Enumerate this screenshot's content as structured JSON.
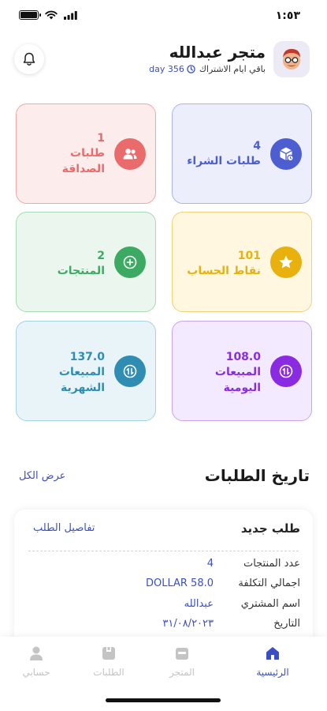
{
  "status_bar": {
    "time": "١:٥٣"
  },
  "header": {
    "store_name": "متجر عبدالله",
    "subscription_label": "باقي ايام الاشتراك",
    "subscription_days": "day 356"
  },
  "stats": [
    {
      "value": "4",
      "label": "طلبات الشراء",
      "label2": "",
      "color": "#4d5fd0",
      "bg": "#eceffb",
      "border": "#aab4ec",
      "icon": "box-icon"
    },
    {
      "value": "1",
      "label": "طلبات",
      "label2": "الصداقة",
      "color": "#ea6b6b",
      "bg": "#fdecec",
      "border": "#f2a8a8",
      "icon": "users-icon"
    },
    {
      "value": "101",
      "label": "نقاط الحساب",
      "label2": "",
      "color": "#e9b10e",
      "bg": "#fff7e0",
      "border": "#f3d27a",
      "icon": "star-icon"
    },
    {
      "value": "2",
      "label": "المنتجات",
      "label2": "",
      "color": "#3caa62",
      "bg": "#ebf7ee",
      "border": "#a8dab6",
      "icon": "plus-circle-icon"
    },
    {
      "value": "108.0",
      "label": "المبيعات",
      "label2": "اليومية",
      "color": "#8a2be2",
      "bg": "#f3eaff",
      "border": "#c9a4f2",
      "icon": "sort-arrows-icon"
    },
    {
      "value": "137.0",
      "label": "المبيعات",
      "label2": "الشهرية",
      "color": "#2f8db3",
      "bg": "#e9f4f8",
      "border": "#a8d1e2",
      "icon": "sort-arrows-icon"
    }
  ],
  "orders": {
    "title": "تاريخ الطلبات",
    "view_all": "عرض الكل",
    "card_title": "طلب جديد",
    "details_link": "تفاصيل الطلب",
    "rows": [
      {
        "label": "عدد المنتجات",
        "value": "4"
      },
      {
        "label": "اجمالي التكلفة",
        "value": "DOLLAR 58.0"
      },
      {
        "label": "اسم المشتري",
        "value": "عبدالله"
      },
      {
        "label": "التاريخ",
        "value": "٣١/٠٨/٢٠٢٣"
      }
    ]
  },
  "nav": [
    {
      "label": "الرئيسية",
      "icon": "home-icon",
      "active": true
    },
    {
      "label": "المتجر",
      "icon": "store-icon",
      "active": false
    },
    {
      "label": "الطلبات",
      "icon": "orders-icon",
      "active": false
    },
    {
      "label": "حسابي",
      "icon": "user-icon",
      "active": false
    }
  ],
  "colors": {
    "accent": "#3b4fc4",
    "inactive_nav": "#c4c4c4"
  }
}
